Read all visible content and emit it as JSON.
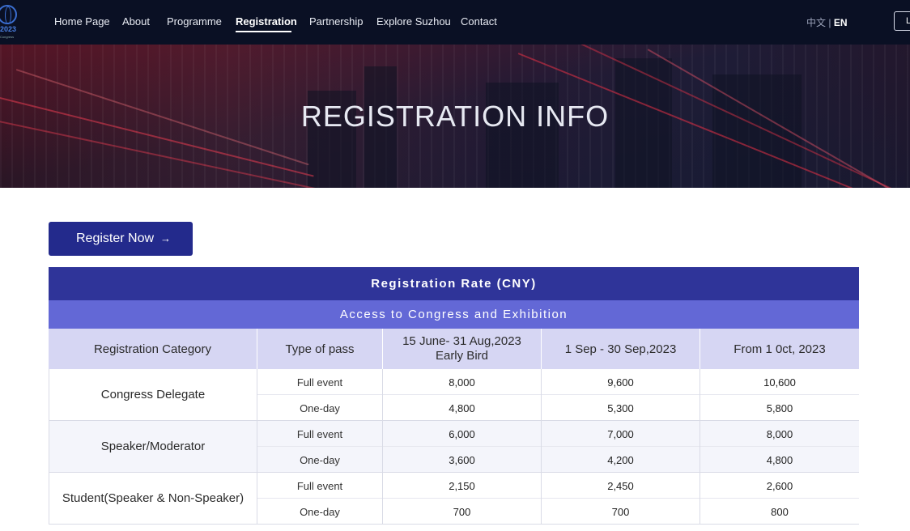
{
  "nav": {
    "logo_text": "2023",
    "logo_sub": "Congress",
    "items": [
      {
        "label": "Home Page"
      },
      {
        "label": "About"
      },
      {
        "label": "Programme"
      },
      {
        "label": "Registration"
      },
      {
        "label": "Partnership"
      },
      {
        "label": "Explore Suzhou"
      },
      {
        "label": "Contact"
      }
    ],
    "active": "Registration",
    "lang_zh": "中文",
    "lang_sep": "|",
    "lang_en": "EN",
    "login_label": "L"
  },
  "hero": {
    "title": "REGISTRATION INFO"
  },
  "register_button": {
    "label": "Register Now",
    "arrow": "→"
  },
  "table": {
    "title": "Registration Rate (CNY)",
    "subtitle": "Access to Congress and Exhibition",
    "columns": [
      "Registration Category",
      "Type of pass",
      "15 June- 31 Aug,2023\nEarly Bird",
      "1 Sep - 30 Sep,2023",
      "From 1 0ct, 2023"
    ],
    "rows": [
      {
        "category": "Congress Delegate",
        "passes": [
          {
            "type": "Full event",
            "prices": [
              "8,000",
              "9,600",
              "10,600"
            ]
          },
          {
            "type": "One-day",
            "prices": [
              "4,800",
              "5,300",
              "5,800"
            ]
          }
        ]
      },
      {
        "category": "Speaker/Moderator",
        "passes": [
          {
            "type": "Full event",
            "prices": [
              "6,000",
              "7,000",
              "8,000"
            ]
          },
          {
            "type": "One-day",
            "prices": [
              "3,600",
              "4,200",
              "4,800"
            ]
          }
        ]
      },
      {
        "category": "Student(Speaker & Non-Speaker)",
        "passes": [
          {
            "type": "Full event",
            "prices": [
              "2,150",
              "2,450",
              "2,600"
            ]
          },
          {
            "type": "One-day",
            "prices": [
              "700",
              "700",
              "800"
            ]
          }
        ]
      }
    ]
  },
  "colors": {
    "nav_bg": "#0a1024",
    "header_dark": "#2f3499",
    "header_mid": "#6368d6",
    "header_light": "#d6d6f3",
    "button": "#232a8c"
  }
}
